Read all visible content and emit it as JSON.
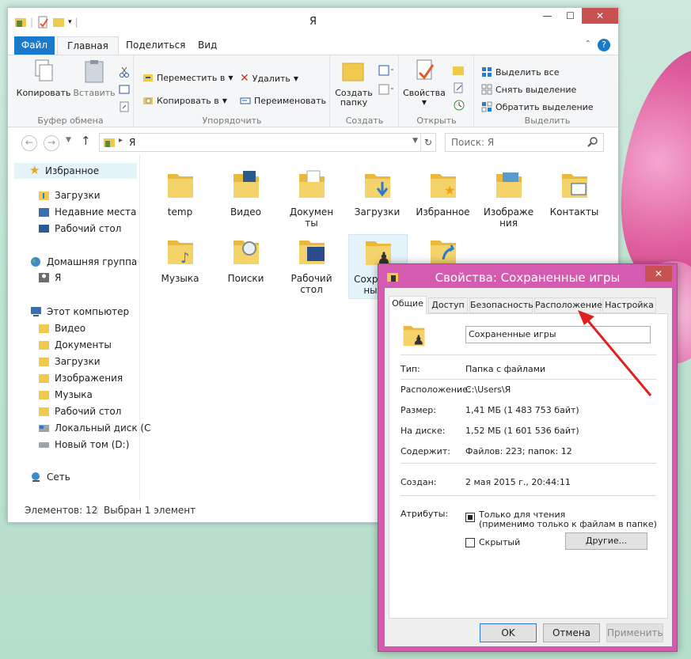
{
  "window": {
    "title": "Я",
    "controls": {
      "minimize": "—",
      "maximize": "☐",
      "close": "✕"
    }
  },
  "ribbon": {
    "tabs": [
      "Файл",
      "Главная",
      "Поделиться",
      "Вид"
    ],
    "help": "?",
    "clipboard": {
      "copy": "Копировать",
      "paste": "Вставить",
      "label": "Буфер обмена"
    },
    "organize": {
      "move_to": "Переместить в",
      "copy_to": "Копировать в",
      "delete": "Удалить",
      "rename": "Переименовать",
      "label": "Упорядочить"
    },
    "new": {
      "new_folder_1": "Создать",
      "new_folder_2": "папку",
      "label": "Создать"
    },
    "open": {
      "properties": "Свойства",
      "label": "Открыть"
    },
    "select": {
      "select_all": "Выделить все",
      "select_none": "Снять выделение",
      "invert": "Обратить выделение",
      "label": "Выделить"
    }
  },
  "address": {
    "path_part": "Я",
    "search_placeholder": "Поиск: Я"
  },
  "nav": {
    "favorites": "Избранное",
    "favorites_items": [
      "Загрузки",
      "Недавние места",
      "Рабочий стол"
    ],
    "homegroup": "Домашняя группа",
    "homegroup_items": [
      "Я"
    ],
    "this_pc": "Этот компьютер",
    "this_pc_items": [
      "Видео",
      "Документы",
      "Загрузки",
      "Изображения",
      "Музыка",
      "Рабочий стол",
      "Локальный диск (C",
      "Новый том (D:)"
    ],
    "network": "Сеть"
  },
  "files": [
    {
      "line1": "temp",
      "line2": ""
    },
    {
      "line1": "Видео",
      "line2": ""
    },
    {
      "line1": "Докумен",
      "line2": "ты"
    },
    {
      "line1": "Загрузки",
      "line2": ""
    },
    {
      "line1": "Избранное",
      "line2": ""
    },
    {
      "line1": "Изображе",
      "line2": "ния"
    },
    {
      "line1": "Контакты",
      "line2": ""
    },
    {
      "line1": "Музыка",
      "line2": ""
    },
    {
      "line1": "Поиски",
      "line2": ""
    },
    {
      "line1": "Рабочий",
      "line2": "стол"
    },
    {
      "line1": "Сохранен",
      "line2": "ные и"
    },
    {
      "line1": "",
      "line2": ""
    }
  ],
  "status": {
    "count": "Элементов: 12",
    "selected": "Выбран 1 элемент"
  },
  "dialog": {
    "title": "Свойства: Сохраненные игры",
    "close": "✕",
    "tabs": [
      "Общие",
      "Доступ",
      "Безопасность",
      "Расположение",
      "Настройка"
    ],
    "name_value": "Сохраненные игры",
    "type_label": "Тип:",
    "type_value": "Папка с файлами",
    "location_label": "Расположение:",
    "location_value": "C:\\Users\\Я",
    "size_label": "Размер:",
    "size_value": "1,41 МБ (1 483 753 байт)",
    "disk_label": "На диске:",
    "disk_value": "1,52 МБ (1 601 536 байт)",
    "contains_label": "Содержит:",
    "contains_value": "Файлов: 223; папок: 12",
    "created_label": "Создан:",
    "created_value": "2 мая 2015 г., 20:44:11",
    "attrs_label": "Атрибуты:",
    "readonly_1": "Только для чтения",
    "readonly_2": "(применимо только к файлам в папке)",
    "hidden": "Скрытый",
    "other_button": "Другие...",
    "ok": "OK",
    "cancel": "Отмена",
    "apply": "Применить"
  },
  "colors": {
    "accent": "#1979ca",
    "dialog_frame": "#d55bb0",
    "arrow": "#e02020"
  }
}
